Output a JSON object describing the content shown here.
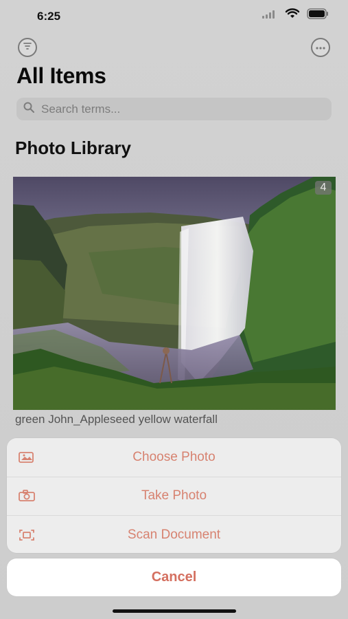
{
  "status_bar": {
    "time": "6:25",
    "icons": [
      "signal-icon",
      "wifi-icon",
      "battery-icon"
    ]
  },
  "toolbar": {
    "filter_icon": "filter-icon",
    "more_icon": "more-icon"
  },
  "header": {
    "title": "All Items"
  },
  "search": {
    "placeholder": "Search terms..."
  },
  "section": {
    "title": "Photo Library"
  },
  "photo": {
    "count": "4",
    "caption": "green John_Appleseed yellow waterfall"
  },
  "action_sheet": {
    "items": [
      {
        "label": "Choose Photo",
        "icon": "photo-icon"
      },
      {
        "label": "Take Photo",
        "icon": "camera-icon"
      },
      {
        "label": "Scan Document",
        "icon": "scan-icon"
      }
    ],
    "cancel_label": "Cancel"
  },
  "colors": {
    "accent": "#d78270",
    "cancel": "#d46f5f",
    "background": "#d7d7d7"
  }
}
